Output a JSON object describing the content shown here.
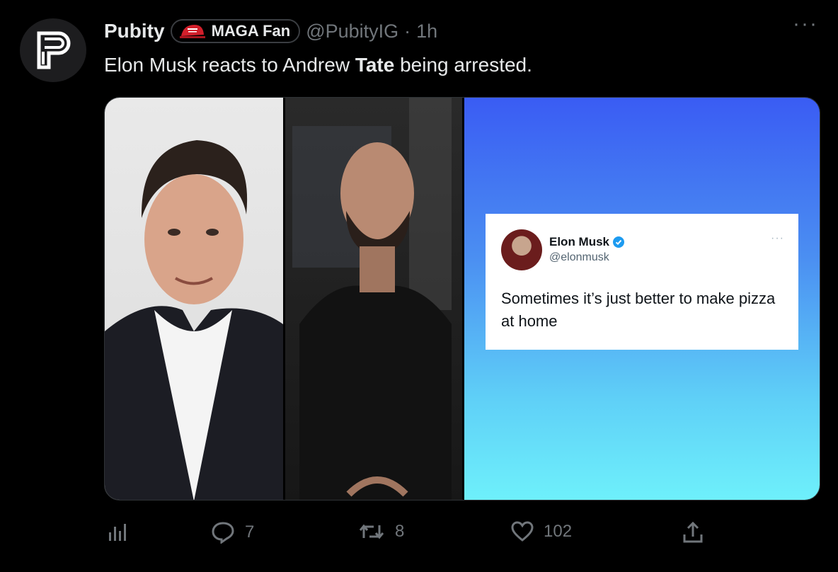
{
  "tweet": {
    "author_name": "Pubity",
    "badge_label": "MAGA Fan",
    "handle": "@PubityIG",
    "separator": "·",
    "time": "1h",
    "text_before": "Elon Musk reacts to Andrew ",
    "text_bold": "Tate",
    "text_after": " being arrested.",
    "more_label": "···"
  },
  "media": {
    "embedded_tweet": {
      "name": "Elon Musk",
      "handle": "@elonmusk",
      "text": "Sometimes it’s just better to make pizza at home",
      "more_label": "···"
    },
    "colors": {
      "gradient_top": "#3a5cf3",
      "gradient_bottom": "#6ef0fb"
    }
  },
  "actions": {
    "analytics": {
      "icon": "bar-chart-icon"
    },
    "reply": {
      "icon": "reply-icon",
      "count": "7"
    },
    "retweet": {
      "icon": "retweet-icon",
      "count": "8"
    },
    "like": {
      "icon": "heart-icon",
      "count": "102"
    },
    "share": {
      "icon": "share-icon"
    }
  },
  "colors": {
    "background": "#000000",
    "text": "#e7e9ea",
    "muted": "#71767b",
    "verified": "#1d9bf0"
  }
}
